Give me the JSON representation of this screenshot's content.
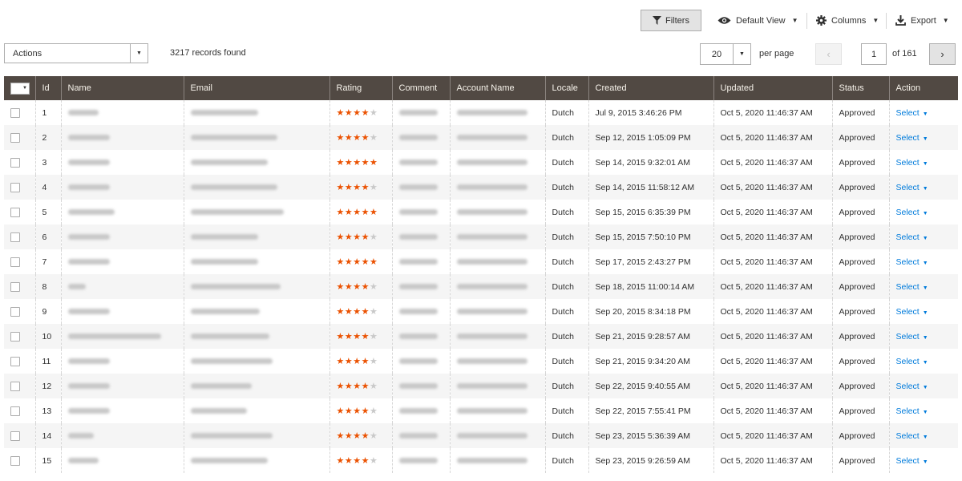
{
  "toolbar": {
    "filters_label": "Filters",
    "view_label": "Default View",
    "columns_label": "Columns",
    "export_label": "Export"
  },
  "mass_actions": {
    "label": "Actions"
  },
  "records_found": "3217 records found",
  "pagination": {
    "page_size": "20",
    "per_page_label": "per page",
    "current_page": "1",
    "of_label": "of 161"
  },
  "table": {
    "columns": [
      "Id",
      "Name",
      "Email",
      "Rating",
      "Comment",
      "Account Name",
      "Locale",
      "Created",
      "Updated",
      "Status",
      "Action"
    ],
    "rows": [
      {
        "id": "1",
        "rating": 4,
        "locale": "Dutch",
        "created": "Jul 9, 2015 3:46:26 PM",
        "updated": "Oct 5, 2020 11:46:37 AM",
        "status": "Approved",
        "action": "Select"
      },
      {
        "id": "2",
        "rating": 4,
        "locale": "Dutch",
        "created": "Sep 12, 2015 1:05:09 PM",
        "updated": "Oct 5, 2020 11:46:37 AM",
        "status": "Approved",
        "action": "Select"
      },
      {
        "id": "3",
        "rating": 5,
        "locale": "Dutch",
        "created": "Sep 14, 2015 9:32:01 AM",
        "updated": "Oct 5, 2020 11:46:37 AM",
        "status": "Approved",
        "action": "Select"
      },
      {
        "id": "4",
        "rating": 4,
        "locale": "Dutch",
        "created": "Sep 14, 2015 11:58:12 AM",
        "updated": "Oct 5, 2020 11:46:37 AM",
        "status": "Approved",
        "action": "Select"
      },
      {
        "id": "5",
        "rating": 5,
        "locale": "Dutch",
        "created": "Sep 15, 2015 6:35:39 PM",
        "updated": "Oct 5, 2020 11:46:37 AM",
        "status": "Approved",
        "action": "Select"
      },
      {
        "id": "6",
        "rating": 4,
        "locale": "Dutch",
        "created": "Sep 15, 2015 7:50:10 PM",
        "updated": "Oct 5, 2020 11:46:37 AM",
        "status": "Approved",
        "action": "Select"
      },
      {
        "id": "7",
        "rating": 5,
        "locale": "Dutch",
        "created": "Sep 17, 2015 2:43:27 PM",
        "updated": "Oct 5, 2020 11:46:37 AM",
        "status": "Approved",
        "action": "Select"
      },
      {
        "id": "8",
        "rating": 4,
        "locale": "Dutch",
        "created": "Sep 18, 2015 11:00:14 AM",
        "updated": "Oct 5, 2020 11:46:37 AM",
        "status": "Approved",
        "action": "Select"
      },
      {
        "id": "9",
        "rating": 4,
        "locale": "Dutch",
        "created": "Sep 20, 2015 8:34:18 PM",
        "updated": "Oct 5, 2020 11:46:37 AM",
        "status": "Approved",
        "action": "Select"
      },
      {
        "id": "10",
        "rating": 4,
        "locale": "Dutch",
        "created": "Sep 21, 2015 9:28:57 AM",
        "updated": "Oct 5, 2020 11:46:37 AM",
        "status": "Approved",
        "action": "Select"
      },
      {
        "id": "11",
        "rating": 4,
        "locale": "Dutch",
        "created": "Sep 21, 2015 9:34:20 AM",
        "updated": "Oct 5, 2020 11:46:37 AM",
        "status": "Approved",
        "action": "Select"
      },
      {
        "id": "12",
        "rating": 4,
        "locale": "Dutch",
        "created": "Sep 22, 2015 9:40:55 AM",
        "updated": "Oct 5, 2020 11:46:37 AM",
        "status": "Approved",
        "action": "Select"
      },
      {
        "id": "13",
        "rating": 4,
        "locale": "Dutch",
        "created": "Sep 22, 2015 7:55:41 PM",
        "updated": "Oct 5, 2020 11:46:37 AM",
        "status": "Approved",
        "action": "Select"
      },
      {
        "id": "14",
        "rating": 4,
        "locale": "Dutch",
        "created": "Sep 23, 2015 5:36:39 AM",
        "updated": "Oct 5, 2020 11:46:37 AM",
        "status": "Approved",
        "action": "Select"
      },
      {
        "id": "15",
        "rating": 4,
        "locale": "Dutch",
        "created": "Sep 23, 2015 9:26:59 AM",
        "updated": "Oct 5, 2020 11:46:37 AM",
        "status": "Approved",
        "action": "Select"
      }
    ]
  },
  "icons": {
    "filter": "funnel-icon",
    "view": "eye-icon",
    "columns": "gear-icon",
    "export": "download-icon"
  },
  "colors": {
    "header_bg": "#514943",
    "star_active": "#eb5202",
    "link": "#007bdb"
  }
}
